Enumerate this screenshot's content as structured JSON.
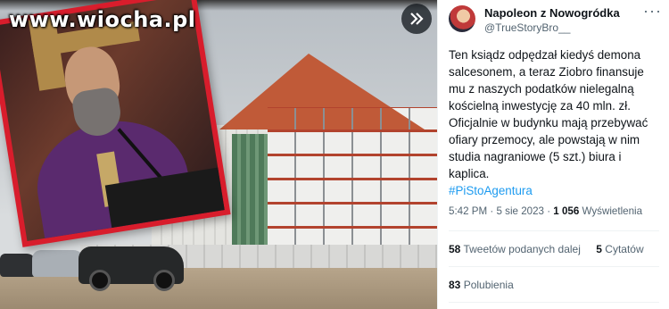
{
  "media": {
    "watermark": "www.wiocha.pl"
  },
  "tweet": {
    "display_name": "Napoleon z Nowogródka",
    "handle": "@TrueStoryBro__",
    "more_label": "···",
    "text_lines": [
      "Ten ksiądz odpędzał kiedyś demona",
      "salcesonem, a teraz Ziobro finansuje",
      "mu z naszych podatków nielegalną",
      "kościelną inwestycję za 40 mln. zł.",
      "Oficjalnie w budynku mają przebywać",
      "ofiary przemocy, ale powstają w nim",
      "studia nagraniowe (5 szt.) biura i",
      "kaplica."
    ],
    "hashtag": "#PiStoAgentura",
    "time": "5:42 PM · 5 sie 2023 · ",
    "views_count": "1 056",
    "views_label": " Wyświetlenia",
    "retweets_count": "58",
    "retweets_label": " Tweetów podanych dalej",
    "quotes_count": "5",
    "quotes_label": " Cytatów",
    "likes_count": "83",
    "likes_label": " Polubienia"
  },
  "icons": {
    "next": "double-chevron-right-icon"
  }
}
